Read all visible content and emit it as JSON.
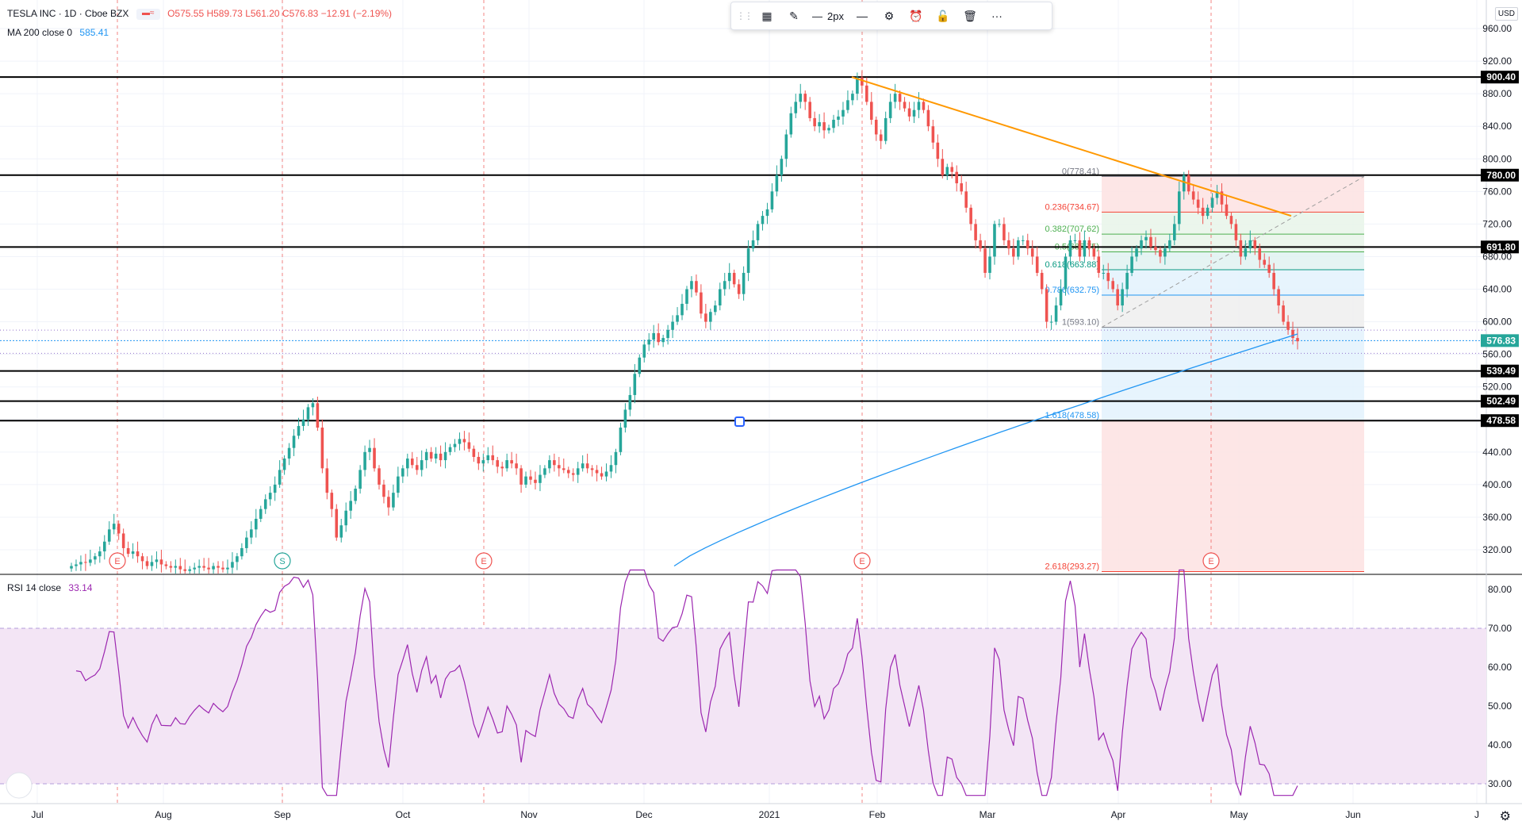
{
  "header": {
    "symbol": "TESLA INC · 1D · Cboe BZX",
    "ohlc_o": "O575.55",
    "ohlc_h": "H589.73",
    "ohlc_l": "L561.20",
    "ohlc_c": "C576.83",
    "change": "−12.91 (−2.19%)",
    "ma_label": "MA 200 close 0",
    "ma_value": "585.41",
    "rsi_label": "RSI 14 close",
    "rsi_value": "33.14",
    "currency": "USD"
  },
  "toolbar": {
    "items": [
      {
        "name": "drag-handle",
        "glyph": "⋮⋮"
      },
      {
        "name": "templates-icon",
        "glyph": "▦"
      },
      {
        "name": "line-color-icon",
        "glyph": "✎"
      },
      {
        "name": "line-width-button",
        "glyph": "—",
        "label": "2px"
      },
      {
        "name": "line-style-icon",
        "glyph": "—"
      },
      {
        "name": "settings-icon",
        "glyph": "⚙"
      },
      {
        "name": "alert-icon",
        "glyph": "⏰"
      },
      {
        "name": "lock-icon",
        "glyph": "🔓"
      },
      {
        "name": "delete-icon",
        "glyph": "🗑"
      },
      {
        "name": "more-icon",
        "glyph": "···"
      }
    ]
  },
  "chart_data": {
    "type": "candlestick",
    "price_axis": {
      "ticks": [
        320,
        360,
        400,
        440,
        480,
        520,
        560,
        600,
        640,
        680,
        720,
        760,
        800,
        840,
        880,
        920,
        960
      ]
    },
    "time_axis": {
      "labels": [
        "Jul",
        "Aug",
        "Sep",
        "Oct",
        "Nov",
        "Dec",
        "2021",
        "Feb",
        "Mar",
        "Apr",
        "May",
        "Jun",
        "J"
      ]
    },
    "horizontal_levels": [
      900.4,
      780.0,
      691.8,
      539.49,
      502.49,
      478.58
    ],
    "last_price": 576.83,
    "colors": {
      "up": "#26a69a",
      "down": "#ef5350",
      "ma": "#2196f3",
      "trend": "#ff9800",
      "rsi": "#9c27b0",
      "rsi_band": "#f3e5f5"
    },
    "fibonacci": [
      {
        "label": "0(778.41)",
        "price": 778.41,
        "color": "#787b86"
      },
      {
        "label": "0.236(734.67)",
        "price": 734.67,
        "color": "#f44336"
      },
      {
        "label": "0.382(707.62)",
        "price": 707.62,
        "color": "#4caf50"
      },
      {
        "label": "0.5(685.75)",
        "price": 685.75,
        "color": "#4caf50"
      },
      {
        "label": "0.618(663.88)",
        "price": 663.88,
        "color": "#089981"
      },
      {
        "label": "0.786(632.75)",
        "price": 632.75,
        "color": "#2196f3"
      },
      {
        "label": "1(593.10)",
        "price": 593.1,
        "color": "#787b86"
      },
      {
        "label": "1.618(478.58)",
        "price": 478.58,
        "color": "#2196f3"
      },
      {
        "label": "2.618(293.27)",
        "price": 293.27,
        "color": "#f44336"
      }
    ],
    "events": [
      {
        "label": "E",
        "color": "#ef5350"
      },
      {
        "label": "S",
        "color": "#26a69a"
      },
      {
        "label": "E",
        "color": "#ef5350"
      },
      {
        "label": "E",
        "color": "#ef5350"
      },
      {
        "label": "E",
        "color": "#ef5350"
      }
    ],
    "candles_close": [
      300,
      302,
      305,
      304,
      308,
      312,
      318,
      330,
      345,
      352,
      340,
      322,
      315,
      318,
      312,
      306,
      300,
      305,
      308,
      302,
      300,
      298,
      300,
      296,
      294,
      296,
      298,
      300,
      298,
      296,
      300,
      298,
      296,
      298,
      305,
      312,
      322,
      335,
      345,
      358,
      370,
      382,
      390,
      400,
      418,
      432,
      445,
      460,
      472,
      480,
      495,
      500,
      470,
      420,
      390,
      370,
      335,
      350,
      368,
      380,
      395,
      418,
      440,
      445,
      420,
      400,
      385,
      372,
      390,
      410,
      420,
      432,
      424,
      418,
      430,
      440,
      432,
      438,
      430,
      440,
      446,
      450,
      456,
      452,
      444,
      434,
      426,
      430,
      436,
      430,
      422,
      420,
      430,
      426,
      420,
      400,
      410,
      406,
      402,
      412,
      420,
      430,
      424,
      420,
      418,
      414,
      412,
      420,
      426,
      420,
      418,
      414,
      410,
      416,
      424,
      440,
      470,
      492,
      510,
      536,
      556,
      572,
      578,
      586,
      575,
      580,
      590,
      600,
      608,
      622,
      640,
      650,
      636,
      610,
      600,
      612,
      620,
      640,
      650,
      660,
      646,
      634,
      660,
      690,
      700,
      720,
      730,
      738,
      760,
      780,
      800,
      830,
      856,
      870,
      880,
      870,
      850,
      840,
      845,
      835,
      838,
      848,
      852,
      860,
      872,
      880,
      900,
      890,
      870,
      848,
      830,
      822,
      850,
      870,
      880,
      870,
      862,
      852,
      860,
      870,
      860,
      840,
      820,
      800,
      780,
      790,
      784,
      770,
      760,
      740,
      720,
      700,
      690,
      660,
      680,
      720,
      720,
      700,
      690,
      680,
      700,
      700,
      690,
      680,
      660,
      640,
      600,
      600,
      620,
      640,
      680,
      700,
      700,
      680,
      700,
      690,
      680,
      660,
      660,
      650,
      640,
      620,
      640,
      660,
      680,
      690,
      700,
      704,
      692,
      688,
      680,
      690,
      700,
      720,
      760,
      780,
      760,
      750,
      740,
      730,
      740,
      752,
      760,
      744,
      730,
      720,
      700,
      680,
      690,
      700,
      690,
      676,
      670,
      660,
      640,
      620,
      600,
      590,
      580,
      576
    ]
  }
}
